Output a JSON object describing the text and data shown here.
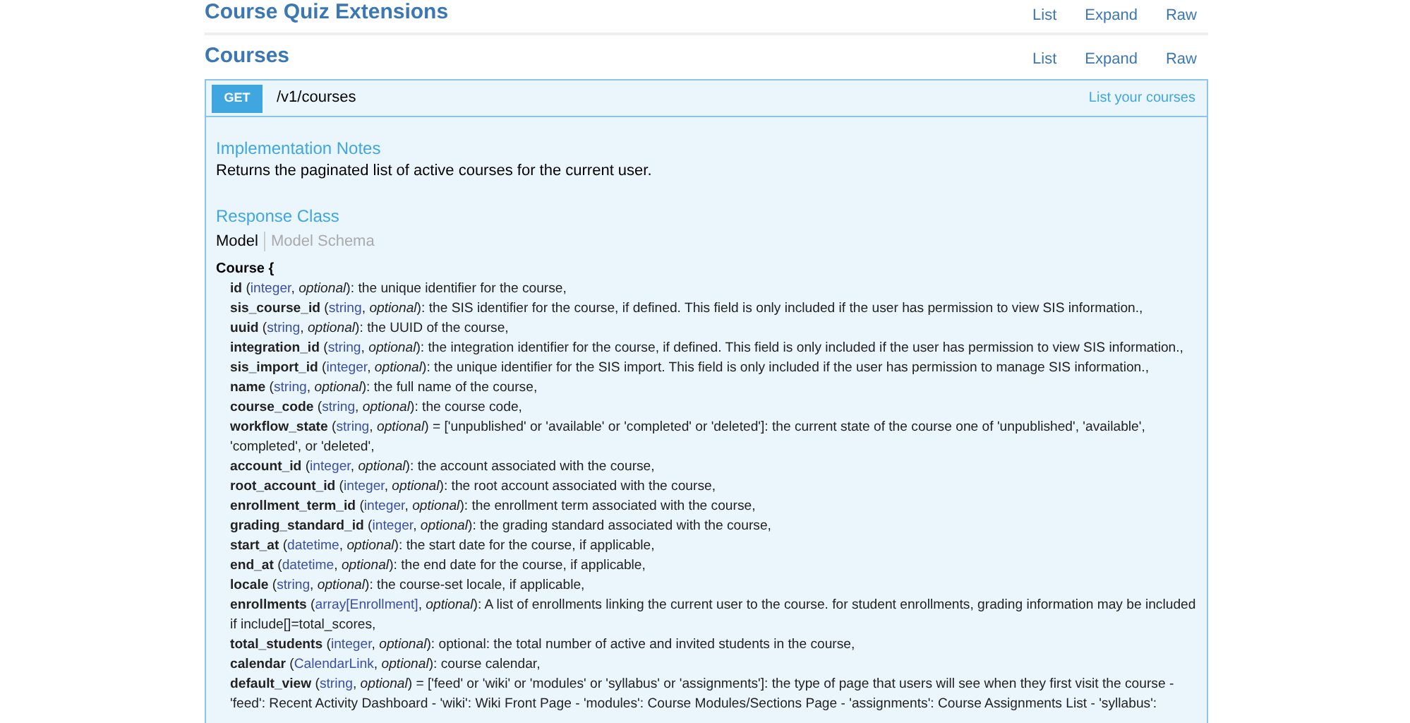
{
  "sections": [
    {
      "title": "Course Quiz Extensions",
      "links": [
        "List",
        "Expand",
        "Raw"
      ]
    },
    {
      "title": "Courses",
      "links": [
        "List",
        "Expand",
        "Raw"
      ]
    }
  ],
  "operation": {
    "method": "GET",
    "path": "/v1/courses",
    "summary": "List your courses",
    "notes_heading": "Implementation Notes",
    "notes": "Returns the paginated list of active courses for the current user.",
    "response_heading": "Response Class",
    "tabs": [
      {
        "label": "Model",
        "selected": true
      },
      {
        "label": "Model Schema",
        "selected": false
      }
    ],
    "model_name": "Course {",
    "fields": [
      {
        "prefix": "**id** (",
        "type": "integer",
        "suffix": ", *optional*): the unique identifier for the course,"
      },
      {
        "prefix": "**sis_course_id** (",
        "type": "string",
        "suffix": ", *optional*): the SIS identifier for the course, if defined. This field is only included if the user has permission to view SIS information.,"
      },
      {
        "prefix": "**uuid** (",
        "type": "string",
        "suffix": ", *optional*): the UUID of the course,"
      },
      {
        "prefix": "**integration_id** (",
        "type": "string",
        "suffix": ", *optional*): the integration identifier for the course, if defined. This field is only included if the user has permission to view SIS information.,"
      },
      {
        "prefix": "**sis_import_id** (",
        "type": "integer",
        "suffix": ", *optional*): the unique identifier for the SIS import. This field is only included if the user has permission to manage SIS information.,"
      },
      {
        "prefix": "**name** (",
        "type": "string",
        "suffix": ", *optional*): the full name of the course,"
      },
      {
        "prefix": "**course_code** (",
        "type": "string",
        "suffix": ", *optional*): the course code,"
      },
      {
        "prefix": "**workflow_state** (",
        "type": "string",
        "suffix": ", *optional*) = ['unpublished' or 'available' or 'completed' or 'deleted']: the current state of the course one of 'unpublished', 'available', 'completed', or 'deleted',"
      },
      {
        "prefix": "**account_id** (",
        "type": "integer",
        "suffix": ", *optional*): the account associated with the course,"
      },
      {
        "prefix": "**root_account_id** (",
        "type": "integer",
        "suffix": ", *optional*): the root account associated with the course,"
      },
      {
        "prefix": "**enrollment_term_id** (",
        "type": "integer",
        "suffix": ", *optional*): the enrollment term associated with the course,"
      },
      {
        "prefix": "**grading_standard_id** (",
        "type": "integer",
        "suffix": ", *optional*): the grading standard associated with the course,"
      },
      {
        "prefix": "**start_at** (",
        "type": "datetime",
        "suffix": ", *optional*): the start date for the course, if applicable,"
      },
      {
        "prefix": "**end_at** (",
        "type": "datetime",
        "suffix": ", *optional*): the end date for the course, if applicable,"
      },
      {
        "prefix": "**locale** (",
        "type": "string",
        "suffix": ", *optional*): the course-set locale, if applicable,"
      },
      {
        "prefix": "**enrollments** (",
        "type": "array[Enrollment]",
        "suffix": ", *optional*): A list of enrollments linking the current user to the course. for student enrollments, grading information may be included if include[]=total_scores,"
      },
      {
        "prefix": "**total_students** (",
        "type": "integer",
        "suffix": ", *optional*): optional: the total number of active and invited students in the course,"
      },
      {
        "prefix": "**calendar** (",
        "type": "CalendarLink",
        "suffix": ", *optional*): course calendar,"
      },
      {
        "prefix": "**default_view** (",
        "type": "string",
        "suffix": ", *optional*) = ['feed' or 'wiki' or 'modules' or 'syllabus' or 'assignments']: the type of page that users will see when they first visit the course - 'feed': Recent Activity Dashboard - 'wiki': Wiki Front Page - 'modules': Course Modules/Sections Page - 'assignments': Course Assignments List - 'syllabus':"
      }
    ]
  }
}
